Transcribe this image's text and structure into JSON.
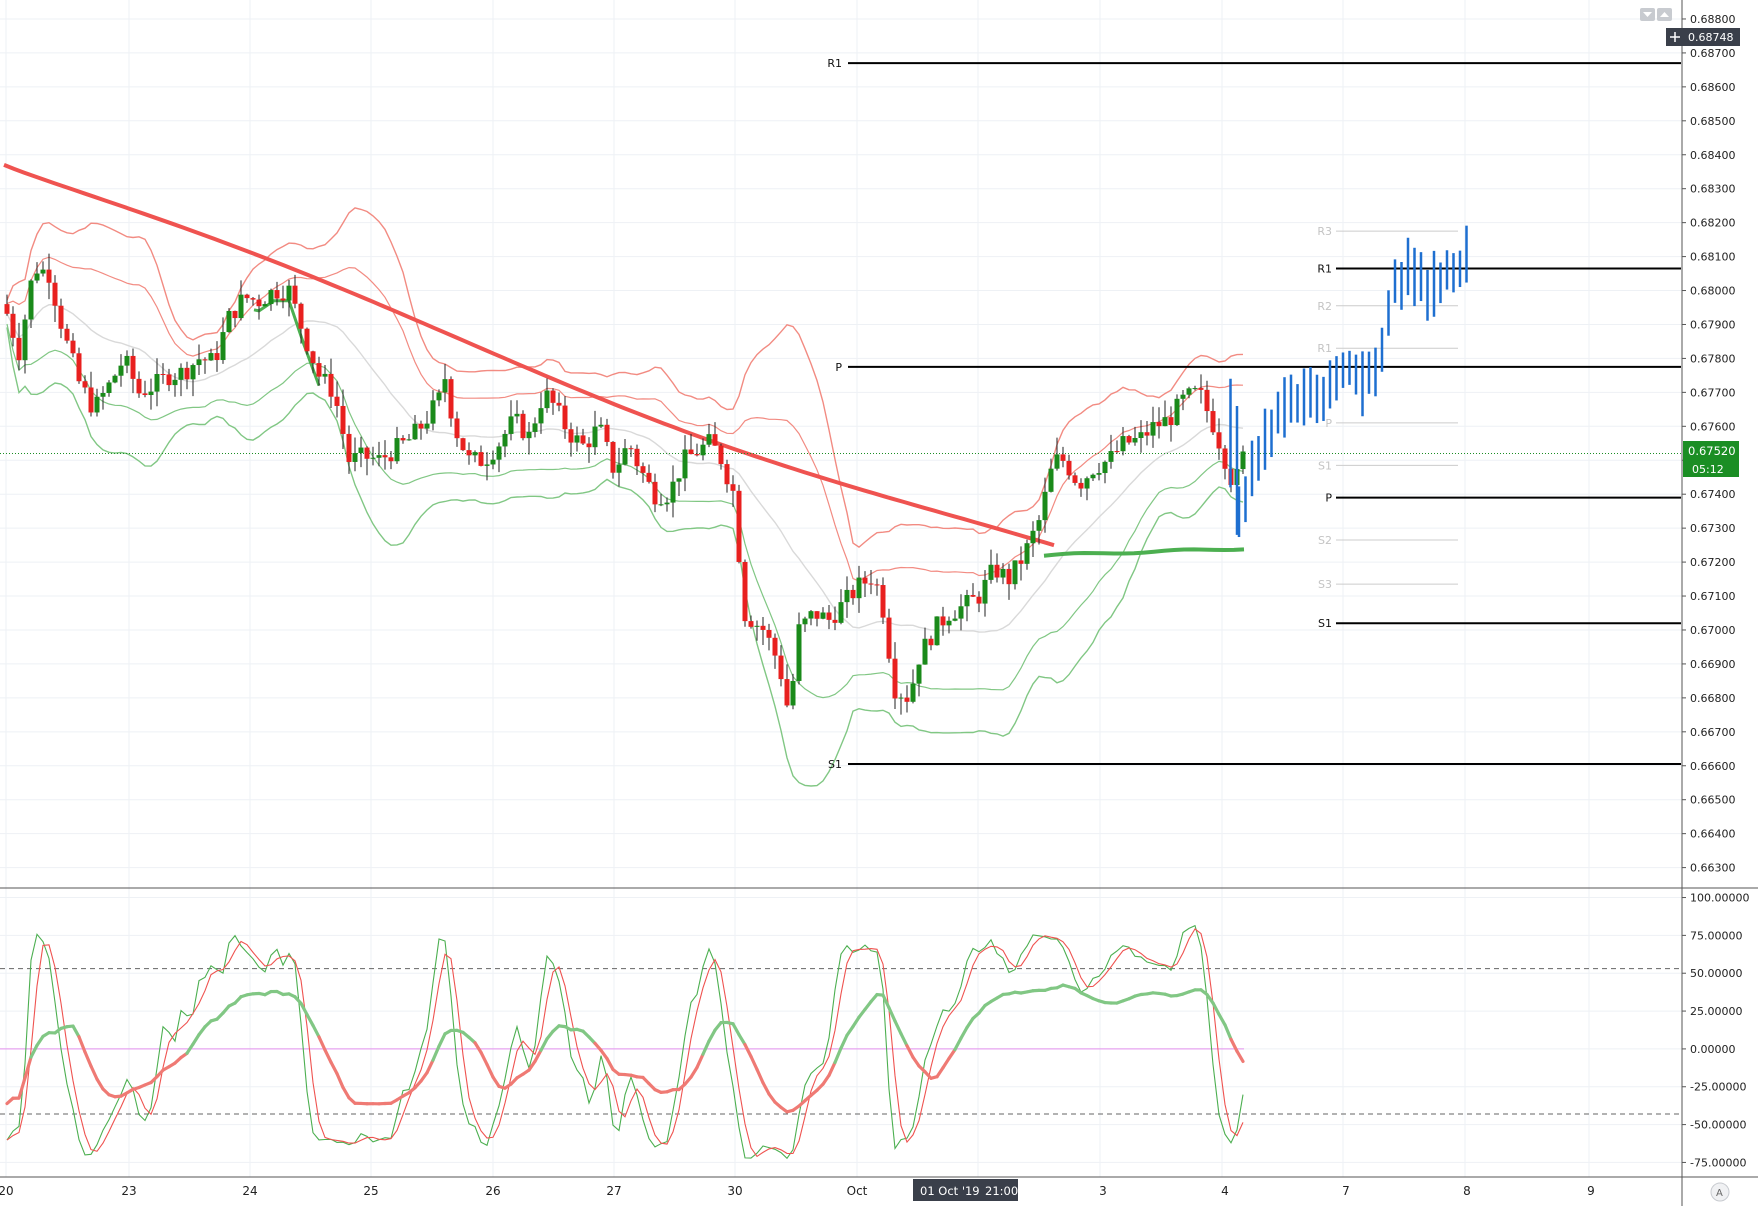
{
  "colors": {
    "up": "#1a8a1a",
    "down": "#e8201f",
    "ma_long": "#ef5350",
    "bb_red": "#f28b82",
    "bb_green": "#81c784",
    "mid_grey": "#d9d9d9",
    "forecast": "#1e6fd0",
    "pivot": "#000000",
    "pivot_faint": "#cccccc",
    "price_tag": "#1b8e24",
    "crosshair_tag": "#3a3f4a",
    "osc_fast": "#4caf50",
    "osc_slow": "#ef5350",
    "osc_thick_up": "#81c784",
    "osc_thick_down": "#ef7a74",
    "zero_line": "#e7a4f0"
  },
  "toolbar": {
    "collapse_icon": "chevron-down-icon",
    "expand_icon": "chevron-up-icon",
    "add_icon": "plus-icon"
  },
  "price_panel": {
    "y_ticks": [
      "0.68800",
      "0.68700",
      "0.68600",
      "0.68500",
      "0.68400",
      "0.68300",
      "0.68200",
      "0.68100",
      "0.68000",
      "0.67900",
      "0.67800",
      "0.67700",
      "0.67600",
      "0.67500",
      "0.67400",
      "0.67300",
      "0.67200",
      "0.67100",
      "0.67000",
      "0.66900",
      "0.66800",
      "0.66700",
      "0.66600",
      "0.66500",
      "0.66400",
      "0.66300"
    ],
    "crosshair_price": "0.68748",
    "current_price": "0.67520",
    "countdown": "05:12",
    "ylim": [
      0.6625,
      0.6885
    ]
  },
  "osc_panel": {
    "y_ticks": [
      "100.00000",
      "75.00000",
      "50.00000",
      "25.00000",
      "0.00000",
      "-25.00000",
      "-50.00000",
      "-75.00000"
    ],
    "ylim": [
      -80,
      103
    ],
    "dashed_levels": [
      53,
      -43
    ]
  },
  "x_axis": {
    "labels": [
      "20",
      "23",
      "24",
      "25",
      "26",
      "27",
      "30",
      "Oct",
      "3",
      "4",
      "7",
      "8",
      "9"
    ],
    "crosshair_date": "01 Oct '19",
    "crosshair_time": "21:00",
    "auto_scale_label": "A"
  },
  "pivots": {
    "weekly": [
      {
        "label": "R1",
        "value": 0.6867
      },
      {
        "label": "P",
        "value": 0.67775
      },
      {
        "label": "S1",
        "value": 0.66605
      }
    ],
    "daily": [
      {
        "label": "R1",
        "value": 0.68065
      },
      {
        "label": "P",
        "value": 0.6739
      },
      {
        "label": "S1",
        "value": 0.6702
      }
    ],
    "faint": [
      {
        "label": "R3",
        "value": 0.68175
      },
      {
        "label": "R2",
        "value": 0.67955
      },
      {
        "label": "R1",
        "value": 0.6783
      },
      {
        "label": "P",
        "value": 0.6761
      },
      {
        "label": "S1",
        "value": 0.67485
      },
      {
        "label": "S2",
        "value": 0.67265
      },
      {
        "label": "S3",
        "value": 0.67135
      }
    ]
  },
  "chart_data": {
    "type": "candlestick",
    "instrument_precision": 5,
    "close_path": [
      [
        0,
        0.6796
      ],
      [
        0.3,
        0.6782
      ],
      [
        0.6,
        0.6807
      ],
      [
        0.9,
        0.6805
      ],
      [
        1.2,
        0.6787
      ],
      [
        1.5,
        0.6773
      ],
      [
        1.8,
        0.6765
      ],
      [
        2.1,
        0.6772
      ],
      [
        2.4,
        0.678
      ],
      [
        2.7,
        0.677
      ],
      [
        3.0,
        0.6772
      ],
      [
        3.3,
        0.6775
      ],
      [
        3.6,
        0.6776
      ],
      [
        3.9,
        0.678
      ],
      [
        4.2,
        0.6779
      ],
      [
        4.5,
        0.6792
      ],
      [
        4.8,
        0.6798
      ],
      [
        5.1,
        0.6797
      ],
      [
        5.4,
        0.68
      ],
      [
        5.7,
        0.68
      ],
      [
        6.0,
        0.6787
      ],
      [
        6.3,
        0.6775
      ],
      [
        6.6,
        0.677
      ],
      [
        6.9,
        0.675
      ],
      [
        7.2,
        0.6751
      ],
      [
        7.5,
        0.675
      ],
      [
        7.8,
        0.6753
      ],
      [
        8.1,
        0.6756
      ],
      [
        8.4,
        0.6761
      ],
      [
        8.7,
        0.6768
      ],
      [
        8.8,
        0.6776
      ],
      [
        9.0,
        0.676
      ],
      [
        9.3,
        0.675
      ],
      [
        9.6,
        0.675
      ],
      [
        9.9,
        0.6755
      ],
      [
        10.2,
        0.6762
      ],
      [
        10.5,
        0.6757
      ],
      [
        10.8,
        0.677
      ],
      [
        11.0,
        0.6766
      ],
      [
        11.3,
        0.6758
      ],
      [
        11.6,
        0.6754
      ],
      [
        11.9,
        0.676
      ],
      [
        12.2,
        0.6747
      ],
      [
        12.5,
        0.6755
      ],
      [
        12.7,
        0.6748
      ],
      [
        13.0,
        0.674
      ],
      [
        13.3,
        0.674
      ],
      [
        13.6,
        0.675
      ],
      [
        13.8,
        0.6752
      ],
      [
        14.1,
        0.6755
      ],
      [
        14.3,
        0.6752
      ],
      [
        14.6,
        0.674
      ],
      [
        14.8,
        0.6705
      ],
      [
        15.2,
        0.67
      ],
      [
        15.5,
        0.669
      ],
      [
        15.7,
        0.6675
      ],
      [
        15.9,
        0.67
      ],
      [
        16.2,
        0.6705
      ],
      [
        16.5,
        0.6703
      ],
      [
        16.8,
        0.6708
      ],
      [
        17.1,
        0.6713
      ],
      [
        17.4,
        0.6716
      ],
      [
        17.6,
        0.6705
      ],
      [
        17.8,
        0.6683
      ],
      [
        18.1,
        0.668
      ],
      [
        18.3,
        0.6692
      ],
      [
        18.6,
        0.67
      ],
      [
        18.9,
        0.6705
      ],
      [
        19.2,
        0.6707
      ],
      [
        19.5,
        0.671
      ],
      [
        19.8,
        0.6718
      ],
      [
        20.1,
        0.6715
      ],
      [
        20.4,
        0.6722
      ],
      [
        20.7,
        0.6732
      ],
      [
        21.0,
        0.675
      ],
      [
        21.2,
        0.675
      ],
      [
        21.5,
        0.6743
      ],
      [
        21.8,
        0.6748
      ],
      [
        22.1,
        0.675
      ],
      [
        22.4,
        0.6755
      ],
      [
        22.7,
        0.6756
      ],
      [
        23.0,
        0.676
      ],
      [
        23.3,
        0.6762
      ],
      [
        23.6,
        0.6768
      ],
      [
        23.9,
        0.677
      ],
      [
        24.2,
        0.676
      ],
      [
        24.5,
        0.6747
      ],
      [
        24.6,
        0.6742
      ],
      [
        24.8,
        0.6752
      ]
    ],
    "overlays": [
      "moving_average_200",
      "bollinger_bands_red",
      "bollinger_bands_green",
      "envelope_mid"
    ],
    "forecast_path": [
      [
        24.8,
        0.674
      ],
      [
        25.2,
        0.6755
      ],
      [
        25.6,
        0.6765
      ],
      [
        26.0,
        0.6768
      ],
      [
        26.4,
        0.677
      ],
      [
        26.8,
        0.6778
      ],
      [
        27.2,
        0.6772
      ],
      [
        27.5,
        0.678
      ],
      [
        27.8,
        0.68
      ],
      [
        28.1,
        0.6808
      ],
      [
        28.4,
        0.68
      ],
      [
        28.7,
        0.6803
      ],
      [
        29.0,
        0.6806
      ],
      [
        29.3,
        0.681
      ]
    ],
    "oscillator": {
      "type": "stochastic",
      "ylim": [
        -80,
        103
      ],
      "levels": [
        53,
        0,
        -43
      ]
    }
  }
}
